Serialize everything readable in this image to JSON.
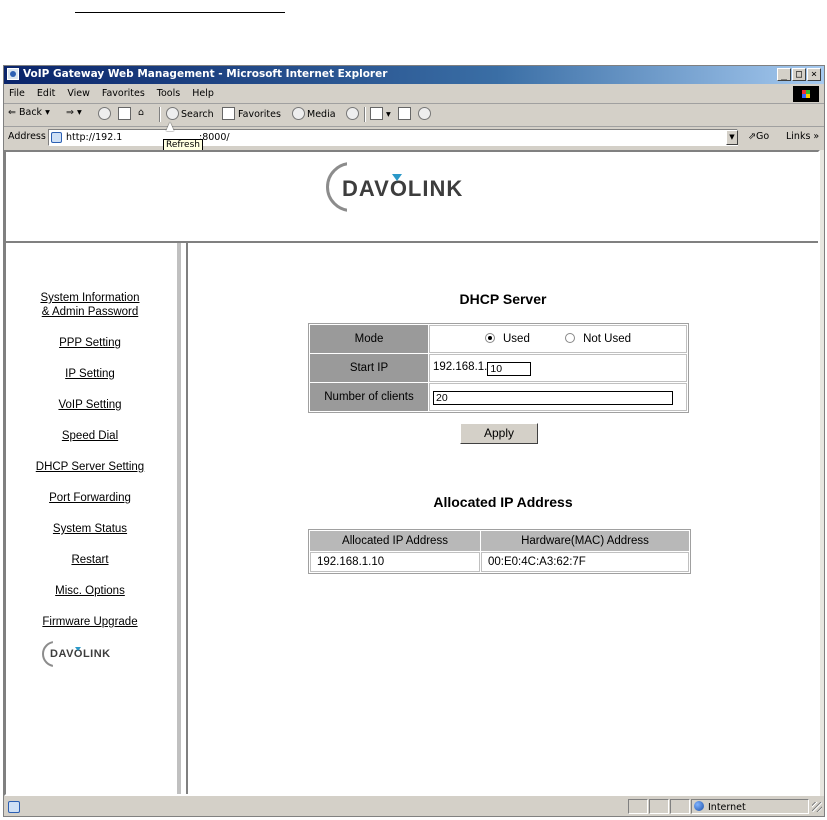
{
  "window": {
    "title": "VoIP Gateway Web Management - Microsoft Internet Explorer",
    "controls": [
      "_",
      "□",
      "×"
    ]
  },
  "menubar": [
    "File",
    "Edit",
    "View",
    "Favorites",
    "Tools",
    "Help"
  ],
  "toolbar": {
    "back": "Back",
    "search": "Search",
    "favorites": "Favorites",
    "media": "Media"
  },
  "address": {
    "label": "Address",
    "url_left": "http://192.1",
    "url_right": ":8000/",
    "tooltip": "Refresh",
    "go": "Go",
    "links": "Links »"
  },
  "brand": {
    "logo": "DAVOLINK"
  },
  "nav": {
    "items": [
      {
        "line1": "System Information",
        "line2": "& Admin Password"
      },
      {
        "line1": "PPP Setting"
      },
      {
        "line1": "IP Setting"
      },
      {
        "line1": "VoIP Setting"
      },
      {
        "line1": "Speed Dial"
      },
      {
        "line1": "DHCP Server Setting"
      },
      {
        "line1": "Port Forwarding"
      },
      {
        "line1": "System Status"
      },
      {
        "line1": "Restart"
      },
      {
        "line1": "Misc. Options"
      },
      {
        "line1": "Firmware Upgrade"
      }
    ]
  },
  "dhcp": {
    "title": "DHCP Server",
    "mode_label": "Mode",
    "mode_options": {
      "used": "Used",
      "not_used": "Not Used"
    },
    "mode_selected": "used",
    "start_ip_label": "Start IP",
    "start_ip_prefix": "192.168.1.",
    "start_ip_value": "10",
    "clients_label": "Number of clients",
    "clients_value": "20",
    "apply": "Apply"
  },
  "allocated": {
    "title": "Allocated IP Address",
    "columns": [
      "Allocated IP Address",
      "Hardware(MAC) Address"
    ],
    "rows": [
      [
        "192.168.1.10",
        "00:E0:4C:A3:62:7F"
      ]
    ]
  },
  "statusbar": {
    "zone": "Internet"
  }
}
